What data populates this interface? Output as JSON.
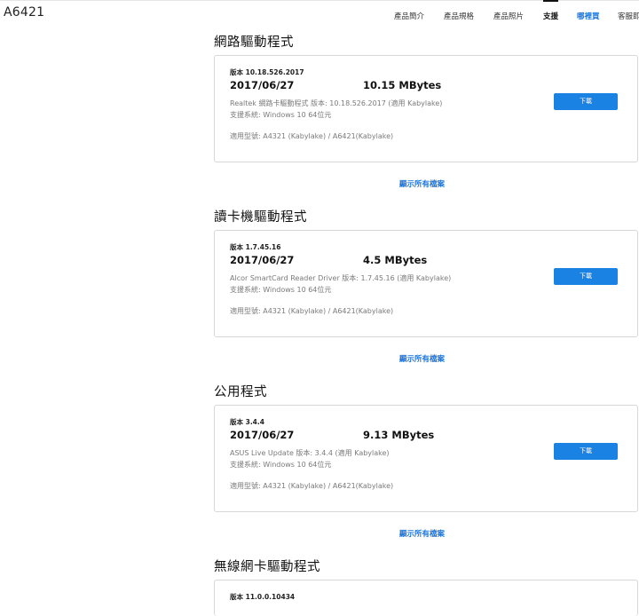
{
  "page": {
    "model": "A6421"
  },
  "nav": {
    "items": [
      {
        "label": "產品簡介"
      },
      {
        "label": "產品規格"
      },
      {
        "label": "產品照片"
      },
      {
        "label": "支援"
      },
      {
        "label": "哪裡買"
      },
      {
        "label": "客服即"
      }
    ]
  },
  "sections": [
    {
      "title": "網路驅動程式",
      "version": "版本 10.18.526.2017",
      "date": "2017/06/27",
      "size": "10.15 MBytes",
      "desc1": "Realtek 網路卡驅動程式 版本: 10.18.526.2017 (適用 Kabylake)",
      "desc2": "支援系統: Windows 10 64位元",
      "models": "適用型號: A4321 (Kabylake) / A6421(Kabylake)",
      "button": "下載",
      "show_all": "顯示所有檔案"
    },
    {
      "title": "讀卡機驅動程式",
      "version": "版本 1.7.45.16",
      "date": "2017/06/27",
      "size": "4.5 MBytes",
      "desc1": "Alcor SmartCard Reader Driver 版本: 1.7.45.16 (適用 Kabylake)",
      "desc2": "支援系統: Windows 10 64位元",
      "models": "適用型號: A4321 (Kabylake) / A6421(Kabylake)",
      "button": "下載",
      "show_all": "顯示所有檔案"
    },
    {
      "title": "公用程式",
      "version": "版本 3.4.4",
      "date": "2017/06/27",
      "size": "9.13 MBytes",
      "desc1": "ASUS Live Update 版本: 3.4.4 (適用 Kabylake)",
      "desc2": "支援系統: Windows 10 64位元",
      "models": "適用型號: A4321 (Kabylake) / A6421(Kabylake)",
      "button": "下載",
      "show_all": "顯示所有檔案"
    },
    {
      "title": "無線網卡驅動程式",
      "version": "版本 11.0.0.10434"
    }
  ]
}
